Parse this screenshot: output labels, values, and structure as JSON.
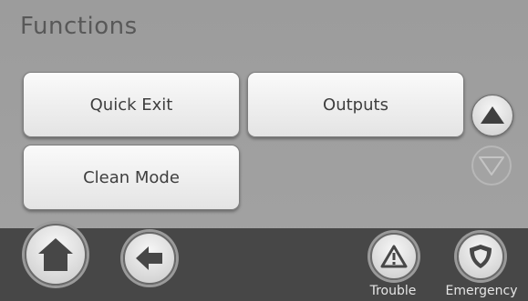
{
  "screen": {
    "title": "Functions"
  },
  "function_buttons": [
    {
      "label": "Quick Exit"
    },
    {
      "label": "Outputs"
    },
    {
      "label": "Clean Mode"
    }
  ],
  "scroll": {
    "up_icon": "arrow-up-icon",
    "down_icon": "arrow-down-icon",
    "down_enabled": false
  },
  "bottom_bar": {
    "home_icon": "home-icon",
    "back_icon": "back-arrow-icon",
    "trouble": {
      "label": "Trouble",
      "icon": "warning-triangle-icon"
    },
    "emergency": {
      "label": "Emergency",
      "icon": "shield-icon"
    }
  }
}
